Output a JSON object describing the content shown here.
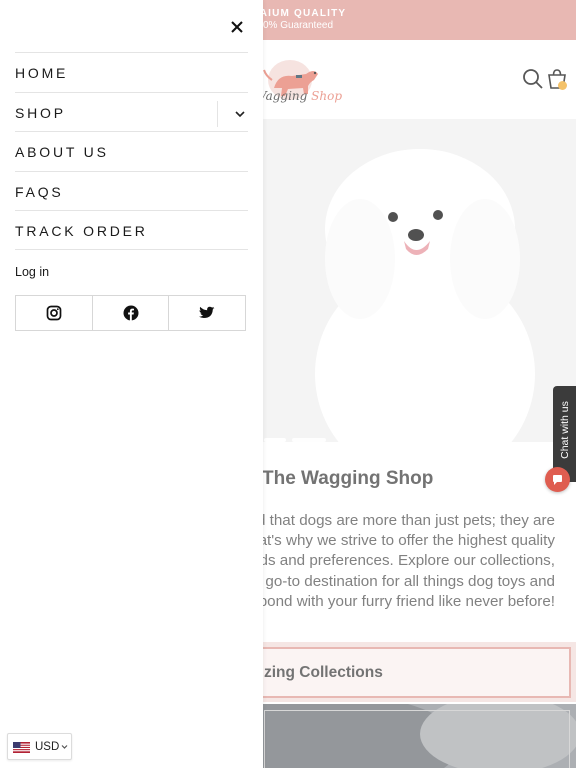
{
  "announcement": {
    "line1": "AIUM QUALITY",
    "line2": "0% Guaranteed"
  },
  "header": {
    "logo_text_main": "Vagging ",
    "logo_text_accent": "Shop",
    "icons": [
      "search-icon",
      "cart-icon"
    ],
    "cart_dot_color": "#f2b54a"
  },
  "hero": {
    "subject": "white fluffy dog"
  },
  "main": {
    "welcome_title": "The Wagging Shop",
    "paragraph_lines": [
      "nd that dogs are more than just pets; they are",
      "hat's why we strive to offer the highest quality",
      "eeds and preferences. Explore our collections,",
      "go-to destination for all things dog toys and",
      "bond with your furry friend like never before!"
    ],
    "collections_button": "zing Collections"
  },
  "chat": {
    "tab_label": "Chat with us"
  },
  "drawer": {
    "nav_items": [
      {
        "label": "HOME"
      },
      {
        "label": "SHOP"
      },
      {
        "label": "ABOUT US"
      },
      {
        "label": "FAQS"
      },
      {
        "label": "TRACK ORDER"
      }
    ],
    "login_label": "Log in",
    "social": [
      "instagram-icon",
      "facebook-icon",
      "twitter-icon"
    ],
    "currency": {
      "code": "USD"
    }
  },
  "colors": {
    "announcement_bg": "#e3a9a3",
    "accent": "#e88b7d",
    "chat_bubble": "#d83a2a"
  }
}
